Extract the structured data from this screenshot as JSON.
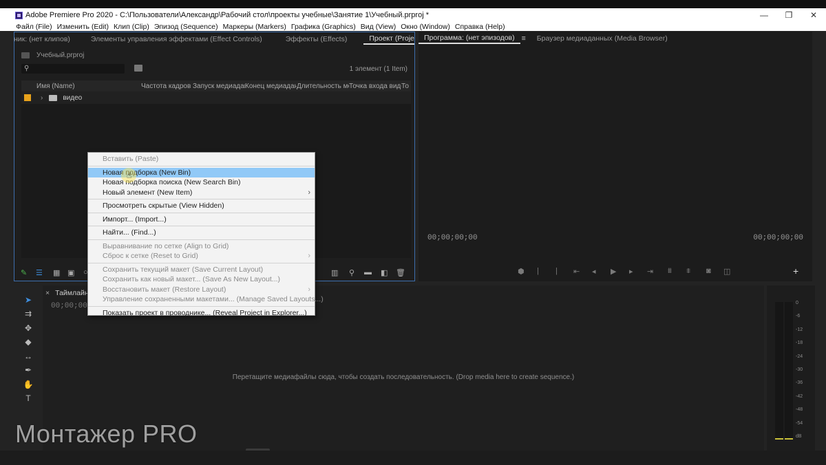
{
  "window": {
    "title": "Adobe Premiere Pro 2020 - C:\\Пользователи\\Александр\\Рабочий стол\\проекты учебные\\Занятие 1\\Учебный.prproj *",
    "minimize": "—",
    "restore": "❐",
    "close": "✕"
  },
  "menubar": [
    "Файл (File)",
    "Изменить (Edit)",
    "Клип (Clip)",
    "Эпизод (Sequence)",
    "Маркеры (Markers)",
    "Графика (Graphics)",
    "Вид (View)",
    "Окно (Window)",
    "Справка (Help)"
  ],
  "project_panel": {
    "tabs": [
      "ник: (нет клипов)",
      "Элементы управления эффектами (Effect Controls)",
      "Эффекты (Effects)",
      "Проект (Project): Учебный"
    ],
    "menu_icon": "≡",
    "overflow_icon": "»",
    "breadcrumb": "Учебный.prproj",
    "item_count": "1 элемент (1 Item)",
    "columns": [
      "Имя (Name)",
      "Частота кадров (F",
      "Запуск медиадан",
      "Конец медиаданн",
      "Длительность ме",
      "Точка входа виде",
      "То"
    ],
    "rows": [
      {
        "name": "видео",
        "label_color": "#e8a21b"
      }
    ]
  },
  "program_panel": {
    "tabs": [
      "Программа: (нет эпизодов)",
      "Браузер медиаданных (Media Browser)"
    ],
    "menu_icon": "≡",
    "timecode_left": "00;00;00;00",
    "timecode_right": "00;00;00;00",
    "add_button": "+"
  },
  "timeline": {
    "close_icon": "×",
    "tab": "Таймлайн (",
    "timecode": "00;00;00;",
    "drop_hint": "Перетащите медиафайлы сюда, чтобы создать последовательность. (Drop media here to create sequence.)"
  },
  "meter": {
    "scale": [
      "0",
      "-6",
      "-12",
      "-18",
      "-24",
      "-30",
      "-36",
      "-42",
      "-48",
      "-54",
      "dB"
    ]
  },
  "context_menu": {
    "items": [
      {
        "label": "Вставить (Paste)",
        "disabled": true
      },
      {
        "sep": true
      },
      {
        "label": "Новая подборка (New Bin)",
        "hover": true
      },
      {
        "label": "Новая подборка поиска (New Search Bin)"
      },
      {
        "label": "Новый элемент (New Item)",
        "submenu": true
      },
      {
        "sep": true
      },
      {
        "label": "Просмотреть скрытые (View Hidden)"
      },
      {
        "sep": true
      },
      {
        "label": "Импорт... (Import...)"
      },
      {
        "sep": true
      },
      {
        "label": "Найти... (Find...)"
      },
      {
        "sep": true
      },
      {
        "label": "Выравнивание по сетке (Align to Grid)",
        "disabled": true
      },
      {
        "label": "Сброс к сетке (Reset to Grid)",
        "disabled": true,
        "submenu": true
      },
      {
        "sep": true
      },
      {
        "label": "Сохранить текущий макет (Save Current Layout)",
        "disabled": true
      },
      {
        "label": "Сохранить как новый макет... (Save As New Layout...)",
        "disabled": true
      },
      {
        "label": "Восстановить макет (Restore Layout)",
        "disabled": true,
        "submenu": true
      },
      {
        "label": "Управление сохраненными макетами... (Manage Saved Layouts...)",
        "disabled": true
      },
      {
        "sep": true
      },
      {
        "label": "Показать проект в проводнике... (Reveal Project in Explorer...)"
      }
    ]
  },
  "watermark": "Монтажер PRO",
  "colors": {
    "accent": "#3e8ede",
    "hover": "#91c9f7",
    "bin_label": "#e8a21b",
    "meter": "#c9c23a"
  }
}
